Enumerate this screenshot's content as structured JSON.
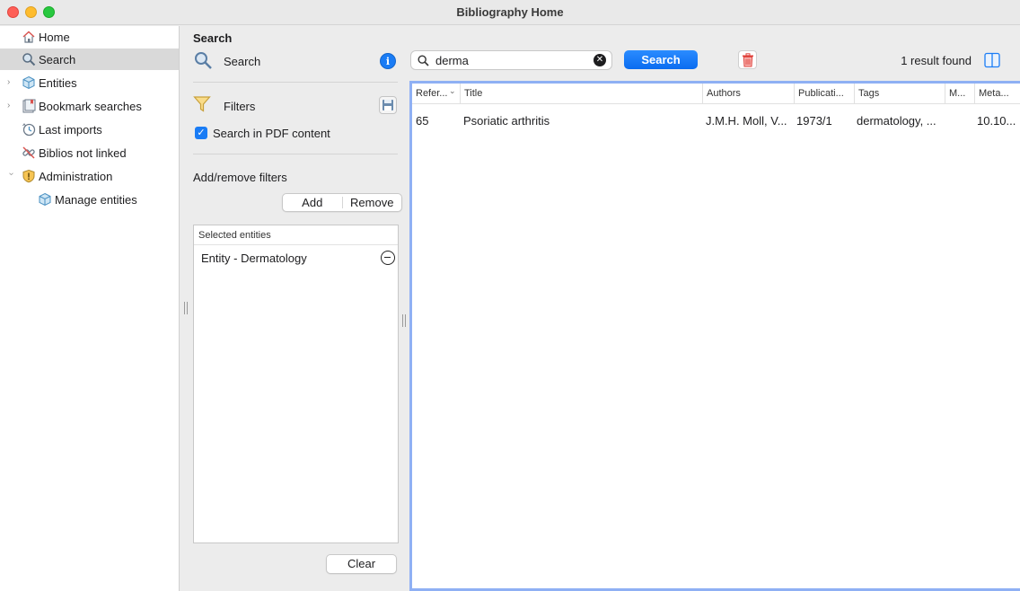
{
  "window": {
    "title": "Bibliography Home"
  },
  "sidebar": {
    "items": [
      {
        "label": "Home",
        "icon": "home-icon"
      },
      {
        "label": "Search",
        "icon": "search-icon",
        "selected": true
      },
      {
        "label": "Entities",
        "icon": "cube-icon",
        "expandable": true
      },
      {
        "label": "Bookmark searches",
        "icon": "bookmark-icon",
        "expandable": true
      },
      {
        "label": "Last imports",
        "icon": "clock-icon"
      },
      {
        "label": "Biblios not linked",
        "icon": "unlink-icon"
      },
      {
        "label": "Administration",
        "icon": "shield-icon",
        "expanded": true
      },
      {
        "label": "Manage entities",
        "icon": "cube-icon"
      }
    ]
  },
  "filter_panel": {
    "section_title": "Search",
    "search_label": "Search",
    "filters_label": "Filters",
    "pdf_checkbox_label": "Search in PDF content",
    "pdf_checked": true,
    "add_remove_label": "Add/remove filters",
    "add_label": "Add",
    "remove_label": "Remove",
    "selected_header": "Selected entities",
    "selected_entities": [
      "Entity - Dermatology"
    ],
    "clear_label": "Clear"
  },
  "toolbar": {
    "search_value": "derma",
    "search_button": "Search",
    "result_count": "1 result found"
  },
  "table": {
    "columns": [
      "Refer...",
      "Title",
      "Authors",
      "Publicati...",
      "Tags",
      "M...",
      "Meta..."
    ],
    "rows": [
      [
        "65",
        "Psoriatic arthritis",
        "J.M.H. Moll, V...",
        "1973/1",
        "dermatology, ...",
        "",
        "10.10..."
      ]
    ]
  },
  "colors": {
    "accent": "#1a7cf5",
    "selection": "#d9d9d9",
    "table_focus_border": "#8fb0f4",
    "trash": "#e0443e"
  }
}
